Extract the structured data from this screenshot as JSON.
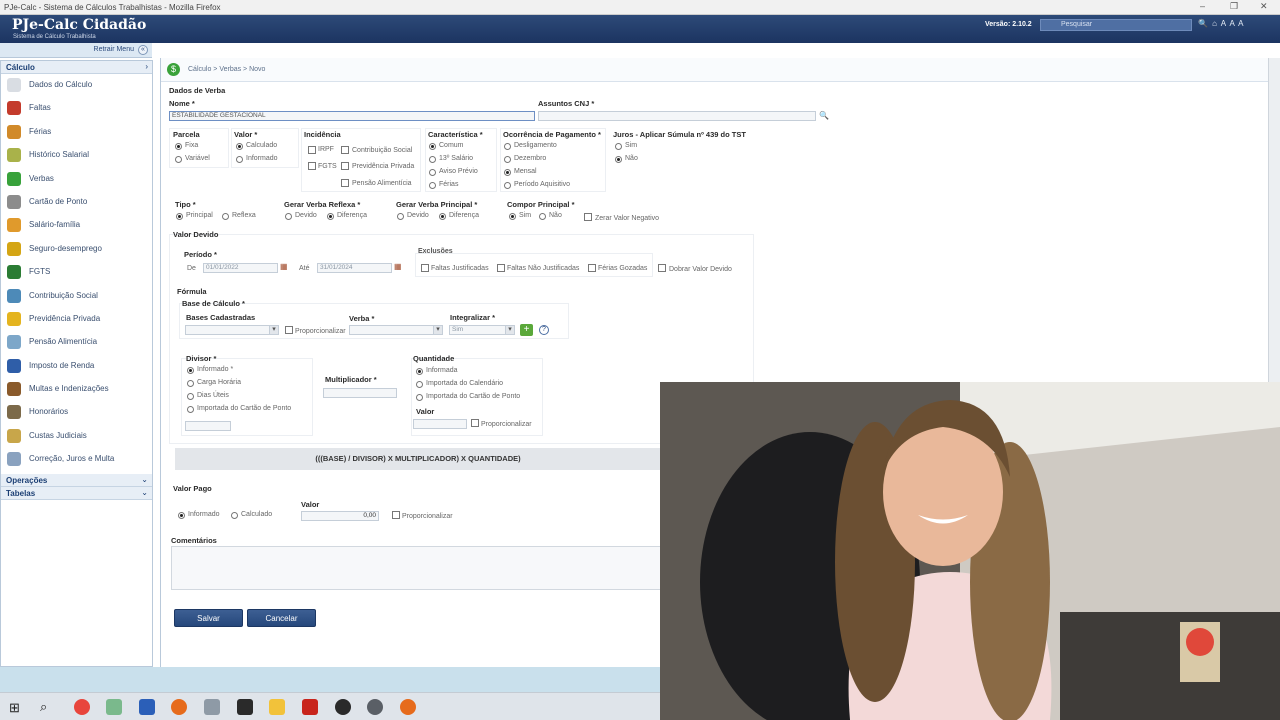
{
  "window": {
    "title": "PJe-Calc - Sistema de Cálculos Trabalhistas - Mozilla Firefox"
  },
  "app": {
    "name": "PJe-Calc Cidadão",
    "subtitle": "Sistema de Cálculo Trabalhista",
    "version": "Versão: 2.10.2",
    "search_placeholder": "Pesquisar"
  },
  "sidebar": {
    "collapse_label": "Retrair Menu",
    "section_calculo": "Cálculo",
    "items": [
      {
        "label": "Dados do Cálculo",
        "icon": "document-icon",
        "color": "#d9dde3"
      },
      {
        "label": "Faltas",
        "icon": "calendar-icon",
        "color": "#c43b2c"
      },
      {
        "label": "Férias",
        "icon": "calendar-grid-icon",
        "color": "#d18a2a"
      },
      {
        "label": "Histórico Salarial",
        "icon": "money-icon",
        "color": "#a9b24a"
      },
      {
        "label": "Verbas",
        "icon": "coin-icon",
        "color": "#38a23b"
      },
      {
        "label": "Cartão de Ponto",
        "icon": "clock-icon",
        "color": "#8c8c8c"
      },
      {
        "label": "Salário-família",
        "icon": "family-icon",
        "color": "#e09a2c"
      },
      {
        "label": "Seguro-desemprego",
        "icon": "person-icon",
        "color": "#d4a514"
      },
      {
        "label": "FGTS",
        "icon": "fgts-icon",
        "color": "#2b7c34"
      },
      {
        "label": "Contribuição Social",
        "icon": "globe-icon",
        "color": "#4d8ab8"
      },
      {
        "label": "Previdência Privada",
        "icon": "piggy-icon",
        "color": "#e4b41f"
      },
      {
        "label": "Pensão Alimentícia",
        "icon": "pension-icon",
        "color": "#7da7c9"
      },
      {
        "label": "Imposto de Renda",
        "icon": "receita-icon",
        "color": "#2f5ea8"
      },
      {
        "label": "Multas e Indenizações",
        "icon": "gavel-icon",
        "color": "#8a5a2b"
      },
      {
        "label": "Honorários",
        "icon": "honorarios-icon",
        "color": "#7c6a4a"
      },
      {
        "label": "Custas Judiciais",
        "icon": "scales-icon",
        "color": "#c8a64a"
      },
      {
        "label": "Correção, Juros e Multa",
        "icon": "chart-icon",
        "color": "#8aa2bf"
      }
    ],
    "section_operacoes": "Operações",
    "section_tabelas": "Tabelas"
  },
  "breadcrumb": "Cálculo > Verbas > Novo",
  "form": {
    "section_title": "Dados de Verba",
    "nome_label": "Nome *",
    "nome_value": "ESTABILIDADE GESTACIONAL",
    "assuntos_label": "Assuntos CNJ *",
    "parcela": {
      "label": "Parcela",
      "options": [
        "Fixa",
        "Variável"
      ],
      "selected": "Fixa"
    },
    "valor": {
      "label": "Valor *",
      "options": [
        "Calculado",
        "Informado"
      ],
      "selected": "Calculado"
    },
    "incidencia": {
      "label": "Incidência",
      "options": [
        "IRPF",
        "FGTS",
        "Contribuição Social",
        "Previdência Privada",
        "Pensão Alimentícia"
      ]
    },
    "caracteristica": {
      "label": "Característica *",
      "options": [
        "Comum",
        "13º Salário",
        "Aviso Prévio",
        "Férias"
      ],
      "selected": "Comum"
    },
    "ocorrencia": {
      "label": "Ocorrência de Pagamento *",
      "options": [
        "Desligamento",
        "Dezembro",
        "Mensal",
        "Período Aquisitivo"
      ],
      "selected": "Mensal"
    },
    "juros": {
      "label": "Juros - Aplicar Súmula nº 439 do TST",
      "options": [
        "Sim",
        "Não"
      ],
      "selected": "Não"
    },
    "tipo": {
      "label": "Tipo *",
      "options": [
        "Principal",
        "Reflexa"
      ],
      "selected": "Principal"
    },
    "gerar_reflexa": {
      "label": "Gerar Verba Reflexa *",
      "options": [
        "Devido",
        "Diferença"
      ],
      "selected": "Diferença"
    },
    "gerar_principal": {
      "label": "Gerar Verba Principal *",
      "options": [
        "Devido",
        "Diferença"
      ],
      "selected": "Diferença"
    },
    "compor_principal": {
      "label": "Compor Principal *",
      "options": [
        "Sim",
        "Não"
      ],
      "selected": "Sim"
    },
    "zerar_negativo": "Zerar Valor Negativo",
    "valor_devido_title": "Valor Devido",
    "periodo": {
      "label": "Período *",
      "de_label": "De",
      "de_value": "01/01/2022",
      "ate_label": "Até",
      "ate_value": "31/01/2024"
    },
    "exclusoes": {
      "label": "Exclusões",
      "options": [
        "Faltas Justificadas",
        "Faltas Não Justificadas",
        "Férias Gozadas"
      ]
    },
    "dobrar": "Dobrar Valor Devido",
    "formula_title": "Fórmula",
    "base_calculo_label": "Base de Cálculo *",
    "bases_cadastradas_label": "Bases Cadastradas",
    "proporcionalizar": "Proporcionalizar",
    "verba_label": "Verba *",
    "integralizar_label": "Integralizar *",
    "integralizar_value": "Sim",
    "divisor": {
      "label": "Divisor *",
      "options": [
        "Informado *",
        "Carga Horária",
        "Dias Úteis",
        "Importada do Cartão de Ponto"
      ],
      "selected": "Informado *"
    },
    "multiplicador_label": "Multiplicador *",
    "quantidade": {
      "label": "Quantidade",
      "options": [
        "Informada",
        "Importada do Calendário",
        "Importada do Cartão de Ponto"
      ],
      "selected": "Informada",
      "valor_label": "Valor"
    },
    "formula_text": "(((BASE) / DIVISOR) X MULTIPLICADOR) X QUANTIDADE)",
    "valor_pago_title": "Valor Pago",
    "valor_pago": {
      "options": [
        "Informado",
        "Calculado"
      ],
      "selected": "Informado",
      "valor_label": "Valor",
      "valor_value": "0,00"
    },
    "comentarios_label": "Comentários",
    "save_label": "Salvar",
    "cancel_label": "Cancelar"
  }
}
